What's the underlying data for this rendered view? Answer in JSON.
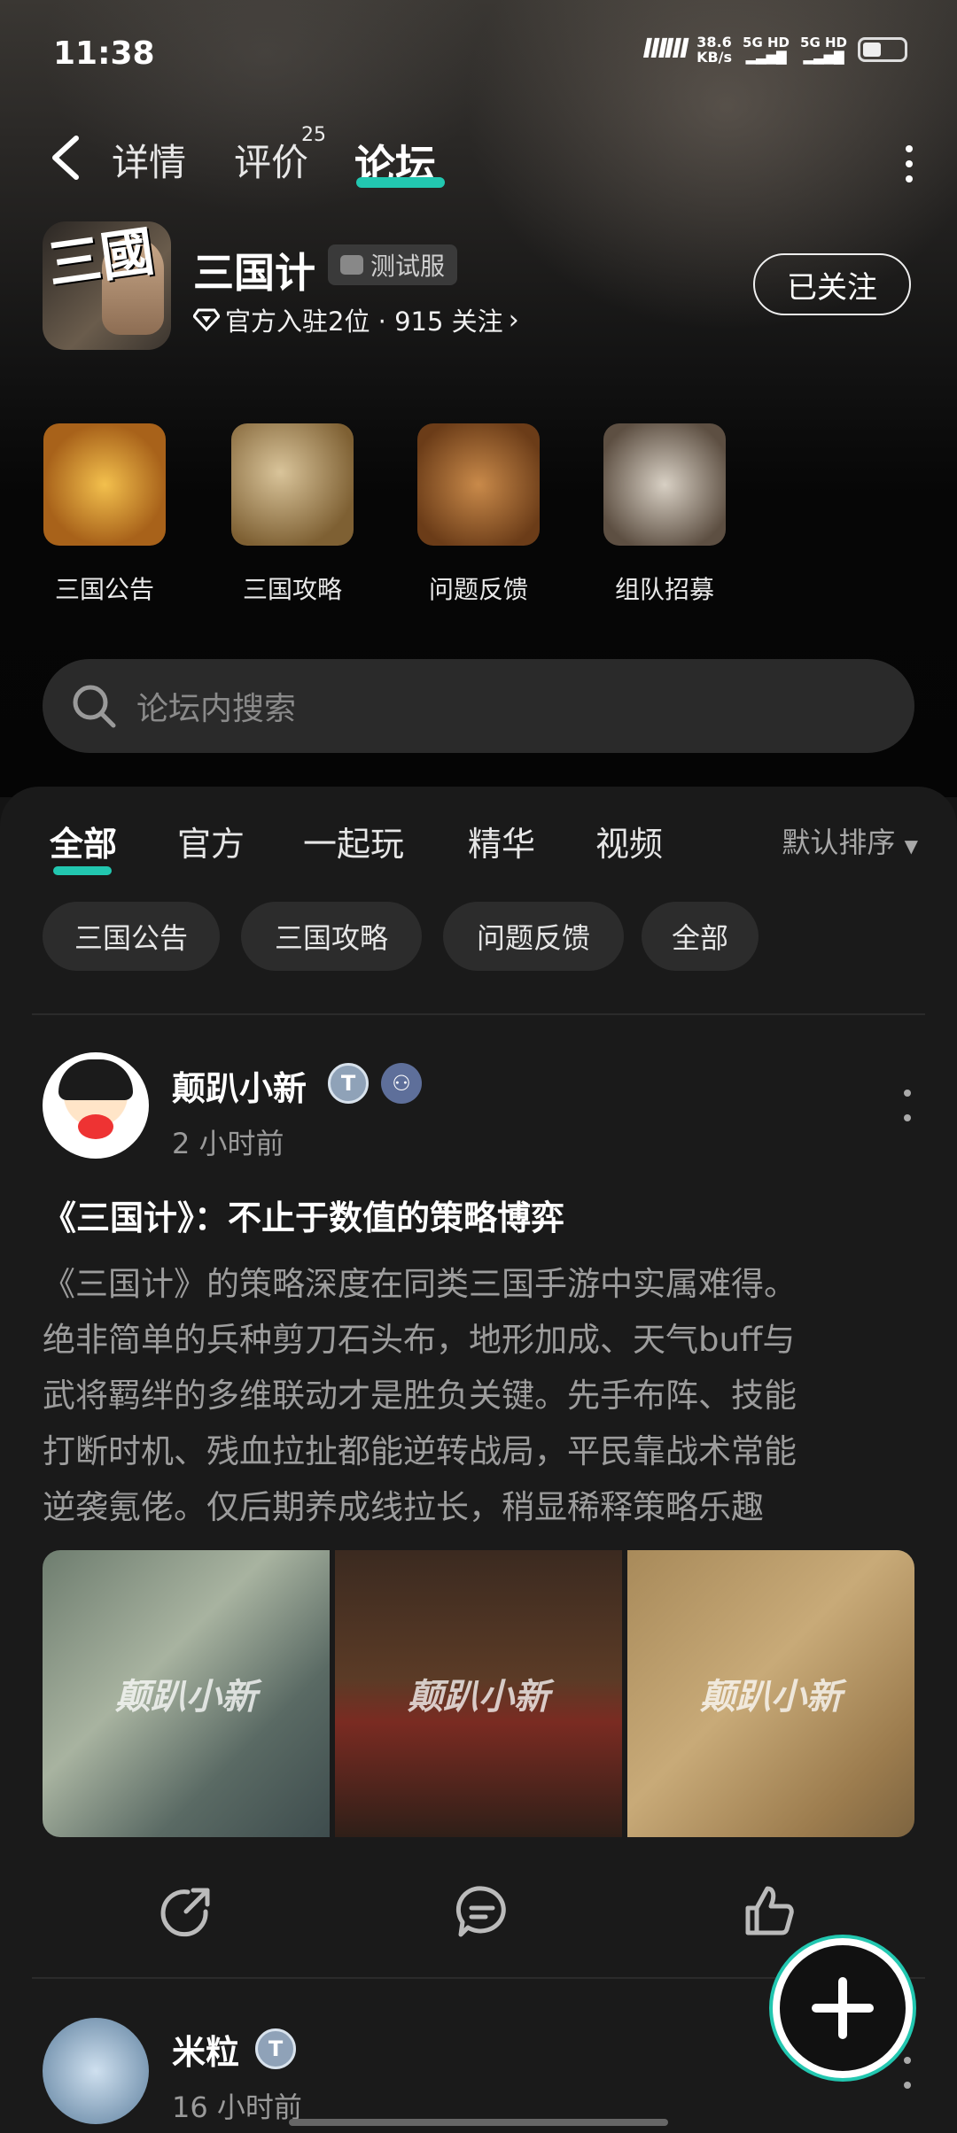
{
  "status": {
    "time": "11:38",
    "speed_value": "38.6",
    "speed_unit": "KB/s",
    "sig1": "5G HD",
    "sig2": "5G HD"
  },
  "nav": {
    "tabs": [
      {
        "label": "详情"
      },
      {
        "label": "评价"
      },
      {
        "label": "论坛"
      }
    ],
    "review_count": "25"
  },
  "game": {
    "icon_text": "三國",
    "title": "三国计",
    "tag": "测试服",
    "meta": "官方入驻2位 · 915 关注",
    "follow_label": "已关注"
  },
  "quick_links": [
    {
      "label": "三国公告",
      "icon": "scroll-icon"
    },
    {
      "label": "三国攻略",
      "icon": "map-icon"
    },
    {
      "label": "问题反馈",
      "icon": "brush-icon"
    },
    {
      "label": "组队招募",
      "icon": "weapons-icon"
    }
  ],
  "search": {
    "placeholder": "论坛内搜索"
  },
  "filter_tabs": [
    {
      "label": "全部"
    },
    {
      "label": "官方"
    },
    {
      "label": "一起玩"
    },
    {
      "label": "精华"
    },
    {
      "label": "视频"
    }
  ],
  "sort_label": "默认排序",
  "chips": [
    {
      "label": "三国公告"
    },
    {
      "label": "三国攻略"
    },
    {
      "label": "问题反馈"
    },
    {
      "label": "全部"
    }
  ],
  "posts": [
    {
      "author": "颠趴小新",
      "time": "2 小时前",
      "title": "《三国计》：不止于数值的策略博弈",
      "body_lines": [
        "《三国计》的策略深度在同类三国手游中实属难得。",
        "绝非简单的兵种剪刀石头布，地形加成、天气buff与",
        "武将羁绊的多维联动才是胜负关键。先手布阵、技能",
        "打断时机、残血拉扯都能逆转战局，平民靠战术常能",
        "逆袭氪佬。仅后期养成线拉长，稍显稀释策略乐趣"
      ],
      "watermark": "颠趴小新"
    },
    {
      "author": "米粒",
      "time": "16 小时前"
    }
  ],
  "colors": {
    "accent": "#22c7b0",
    "background": "#141414"
  }
}
